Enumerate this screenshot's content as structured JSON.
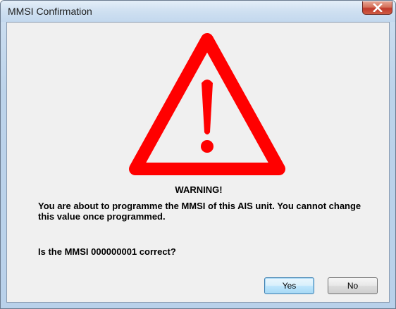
{
  "window": {
    "title": "MMSI Confirmation"
  },
  "icons": {
    "close": "close-icon",
    "warning": "warning-triangle-icon"
  },
  "colors": {
    "warning_red": "#ff0000",
    "title_bar": "#c3d8ee",
    "close_button": "#c0392b",
    "dialog_bg": "#f0f0f0"
  },
  "dialog": {
    "heading": "WARNING!",
    "message": "You are about to programme the MMSI of this AIS unit. You cannot change this value once programmed.",
    "question": "Is the MMSI 000000001 correct?"
  },
  "buttons": {
    "yes_label": "Yes",
    "no_label": "No"
  }
}
